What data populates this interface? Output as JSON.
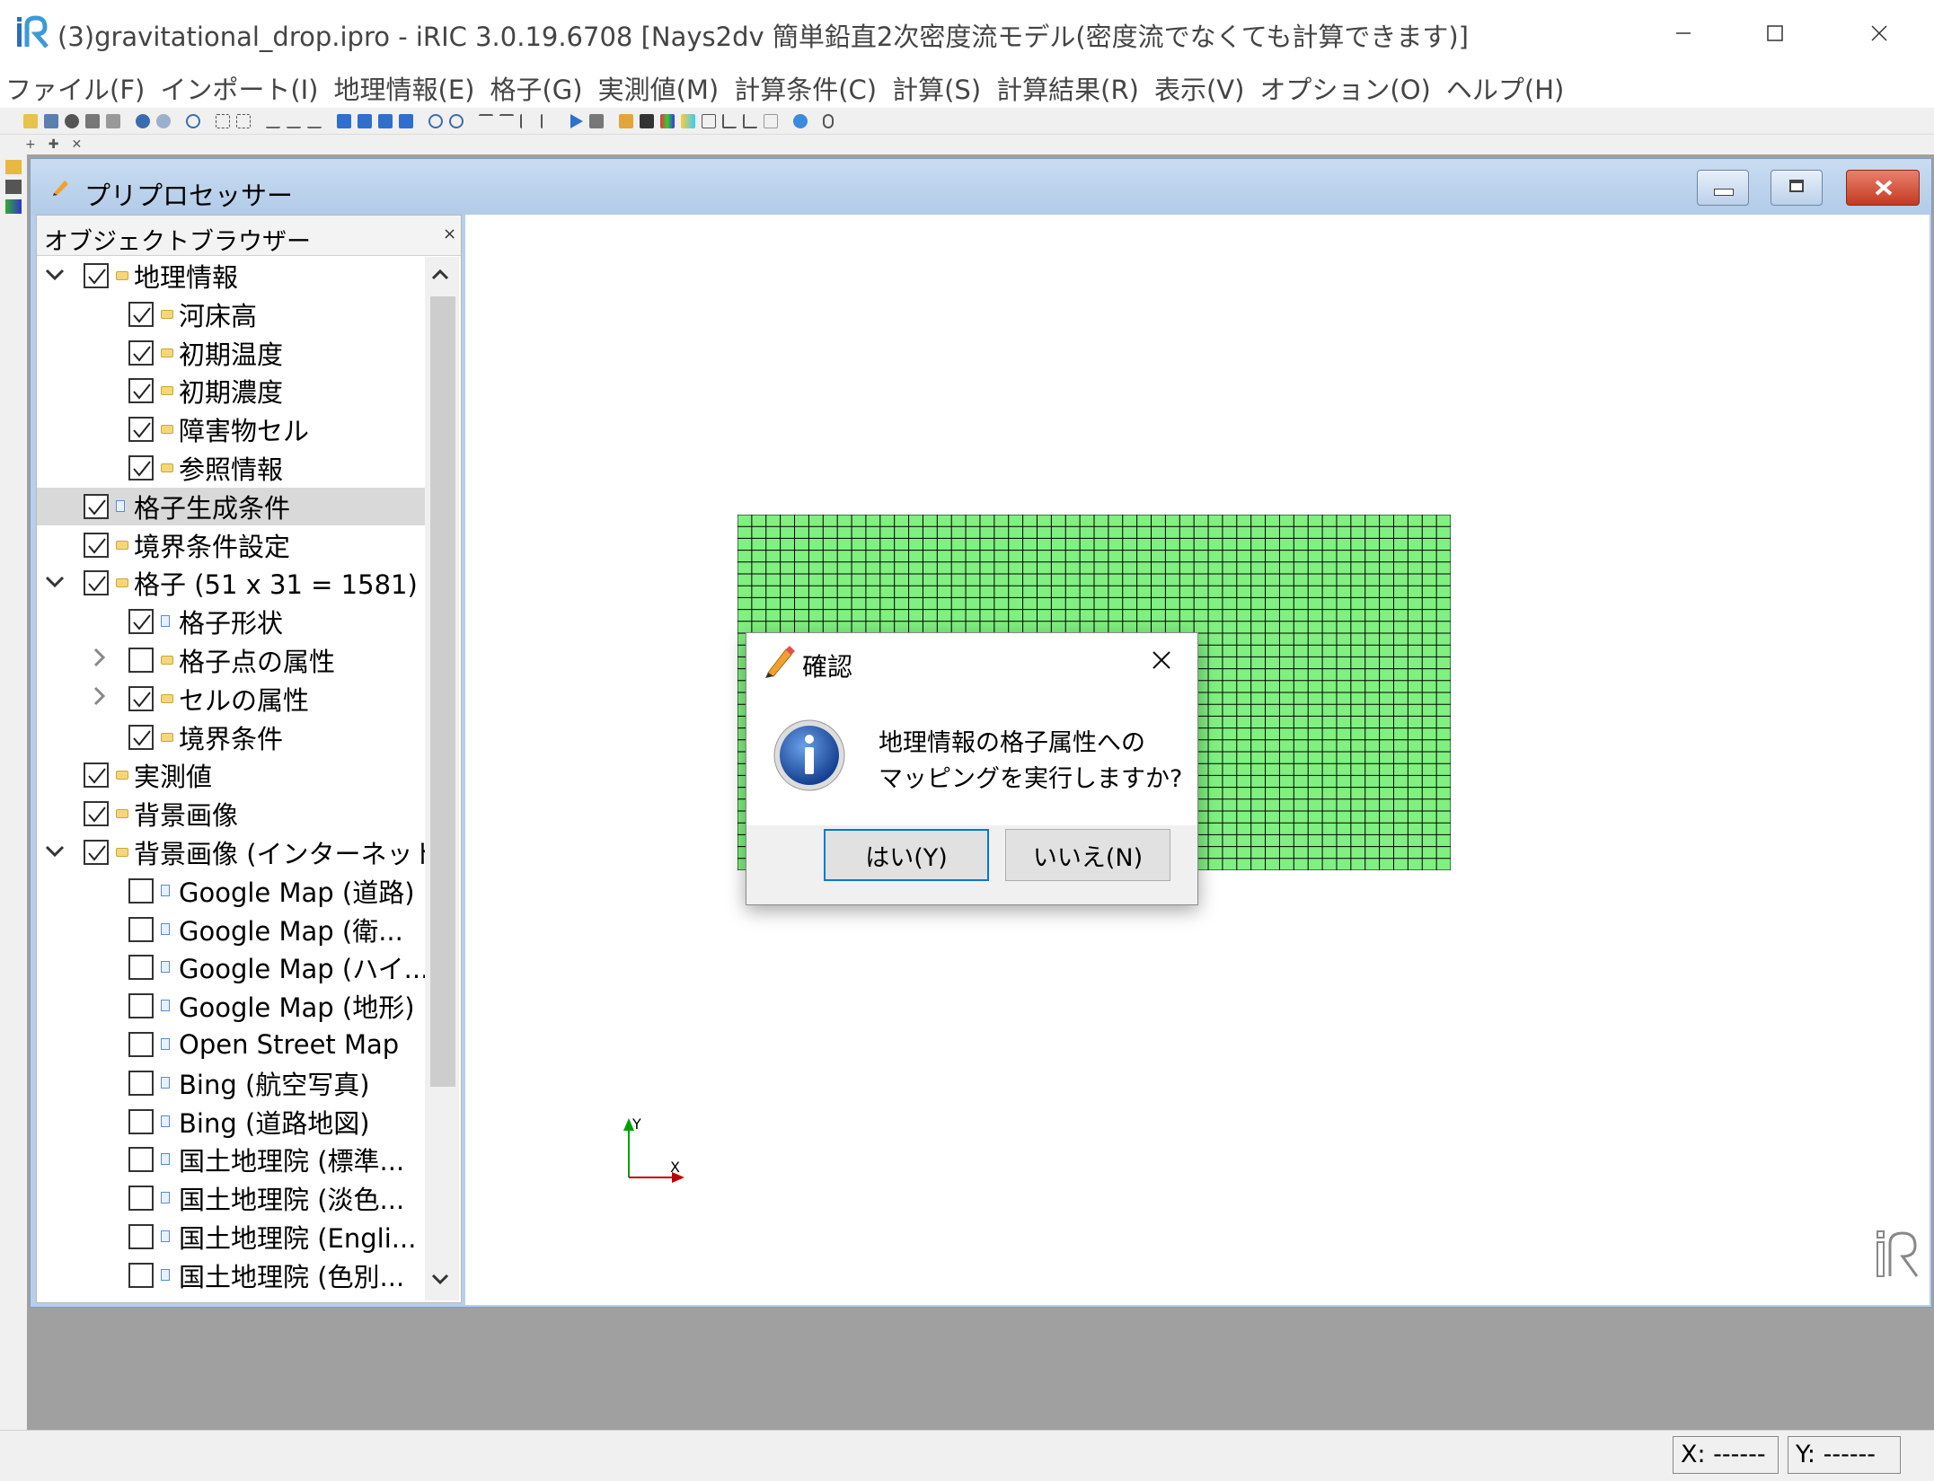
{
  "window": {
    "title": "(3)gravitational_drop.ipro - iRIC 3.0.19.6708 [Nays2dv 簡単鉛直2次密度流モデル(密度流でなくても計算できます)]"
  },
  "menu": [
    "ファイル(F)",
    "インポート(I)",
    "地理情報(E)",
    "格子(G)",
    "実測値(M)",
    "計算条件(C)",
    "計算(S)",
    "計算結果(R)",
    "表示(V)",
    "オプション(O)",
    "ヘルプ(H)"
  ],
  "toolbar2": [
    "+",
    "✚",
    "✕"
  ],
  "child_window": {
    "title": "プリプロセッサー"
  },
  "object_browser": {
    "title": "オブジェクトブラウザー",
    "close": "×",
    "items": [
      {
        "label": "地理情報",
        "level": 0,
        "arrow": "down",
        "checked": true,
        "icon": "folder"
      },
      {
        "label": "河床高",
        "level": 1,
        "arrow": "",
        "checked": true,
        "icon": "folder"
      },
      {
        "label": "初期温度",
        "level": 1,
        "arrow": "",
        "checked": true,
        "icon": "folder"
      },
      {
        "label": "初期濃度",
        "level": 1,
        "arrow": "",
        "checked": true,
        "icon": "folder"
      },
      {
        "label": "障害物セル",
        "level": 1,
        "arrow": "",
        "checked": true,
        "icon": "folder"
      },
      {
        "label": "参照情報",
        "level": 1,
        "arrow": "",
        "checked": true,
        "icon": "folder"
      },
      {
        "label": "格子生成条件",
        "level": 0,
        "arrow": "",
        "checked": true,
        "icon": "doc",
        "selected": true
      },
      {
        "label": "境界条件設定",
        "level": 0,
        "arrow": "",
        "checked": true,
        "icon": "folder"
      },
      {
        "label": "格子 (51 x 31 = 1581)",
        "level": 0,
        "arrow": "down",
        "checked": true,
        "icon": "folder"
      },
      {
        "label": "格子形状",
        "level": 1,
        "arrow": "",
        "checked": true,
        "icon": "doc"
      },
      {
        "label": "格子点の属性",
        "level": 1,
        "arrow": "right",
        "checked": false,
        "icon": "folder"
      },
      {
        "label": "セルの属性",
        "level": 1,
        "arrow": "right",
        "checked": true,
        "icon": "folder"
      },
      {
        "label": "境界条件",
        "level": 1,
        "arrow": "",
        "checked": true,
        "icon": "folder"
      },
      {
        "label": "実測値",
        "level": 0,
        "arrow": "",
        "checked": true,
        "icon": "folder"
      },
      {
        "label": "背景画像",
        "level": 0,
        "arrow": "",
        "checked": true,
        "icon": "folder"
      },
      {
        "label": "背景画像 (インターネット)",
        "level": 0,
        "arrow": "down",
        "checked": true,
        "icon": "folder"
      },
      {
        "label": "Google Map (道路)",
        "level": 1,
        "arrow": "",
        "checked": false,
        "icon": "doc"
      },
      {
        "label": "Google Map (衛...",
        "level": 1,
        "arrow": "",
        "checked": false,
        "icon": "doc"
      },
      {
        "label": "Google Map (ハイ...",
        "level": 1,
        "arrow": "",
        "checked": false,
        "icon": "doc"
      },
      {
        "label": "Google Map (地形)",
        "level": 1,
        "arrow": "",
        "checked": false,
        "icon": "doc"
      },
      {
        "label": "Open Street Map",
        "level": 1,
        "arrow": "",
        "checked": false,
        "icon": "doc"
      },
      {
        "label": "Bing (航空写真)",
        "level": 1,
        "arrow": "",
        "checked": false,
        "icon": "doc"
      },
      {
        "label": "Bing (道路地図)",
        "level": 1,
        "arrow": "",
        "checked": false,
        "icon": "doc"
      },
      {
        "label": "国土地理院 (標準...",
        "level": 1,
        "arrow": "",
        "checked": false,
        "icon": "doc"
      },
      {
        "label": "国土地理院 (淡色...",
        "level": 1,
        "arrow": "",
        "checked": false,
        "icon": "doc"
      },
      {
        "label": "国土地理院 (Engli...",
        "level": 1,
        "arrow": "",
        "checked": false,
        "icon": "doc"
      },
      {
        "label": "国土地理院 (色別...",
        "level": 1,
        "arrow": "",
        "checked": false,
        "icon": "doc"
      }
    ]
  },
  "canvas": {
    "grid_nodes": {
      "i": 51,
      "j": 31
    },
    "grid_fill": "#80f080",
    "axis_x_label": "X",
    "axis_y_label": "Y"
  },
  "status": {
    "x": "X: ------",
    "y": "Y: ------"
  },
  "dialog": {
    "title": "確認",
    "message_line1": "地理情報の格子属性への",
    "message_line2": "マッピングを実行しますか?",
    "yes_label": "はい(Y)",
    "no_label": "いいえ(N)"
  },
  "colors": {
    "accent": "#0078d7",
    "axis_x": "#c00000",
    "axis_y": "#00a000"
  }
}
